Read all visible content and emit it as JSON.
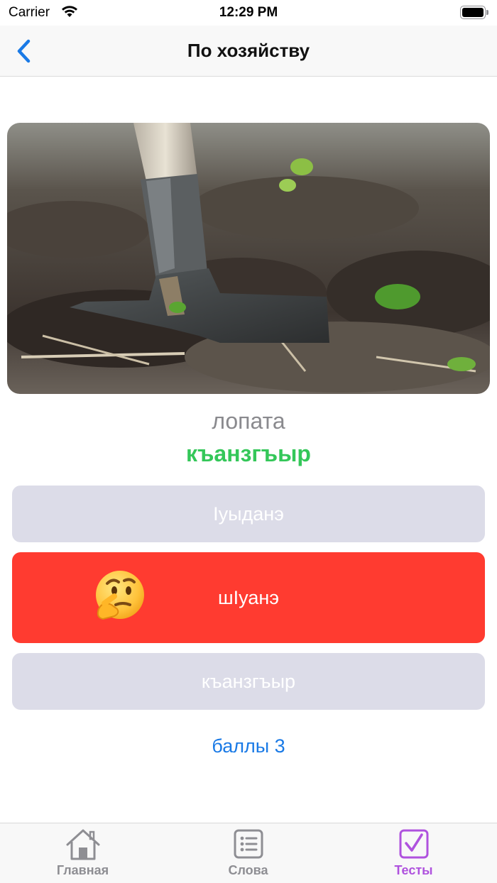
{
  "status_bar": {
    "carrier": "Carrier",
    "time": "12:29 PM",
    "wifi_icon": "wifi-icon",
    "battery_icon": "battery-icon"
  },
  "nav": {
    "title": "По хозяйству",
    "back_icon": "chevron-left-icon",
    "accent_color": "#1a7ae6"
  },
  "question": {
    "image": "shovel-in-soil-photo",
    "word": "лопата",
    "correct_answer": "къанзгъыр"
  },
  "options": [
    {
      "label": "Іуыданэ",
      "state": "default",
      "color": "#dcdce8"
    },
    {
      "label": "шІуанэ",
      "state": "wrong",
      "color": "#ff3b30",
      "icon": "thinking-face-icon"
    },
    {
      "label": "къанзгъыр",
      "state": "default",
      "color": "#dcdce8"
    }
  ],
  "score_label": "баллы 3",
  "tab_bar": {
    "items": [
      {
        "label": "Главная",
        "icon": "home-icon",
        "active": false
      },
      {
        "label": "Слова",
        "icon": "list-icon",
        "active": false
      },
      {
        "label": "Тесты",
        "icon": "checkbox-icon",
        "active": true
      }
    ],
    "active_color": "#af52de",
    "inactive_color": "#8e8e93"
  }
}
